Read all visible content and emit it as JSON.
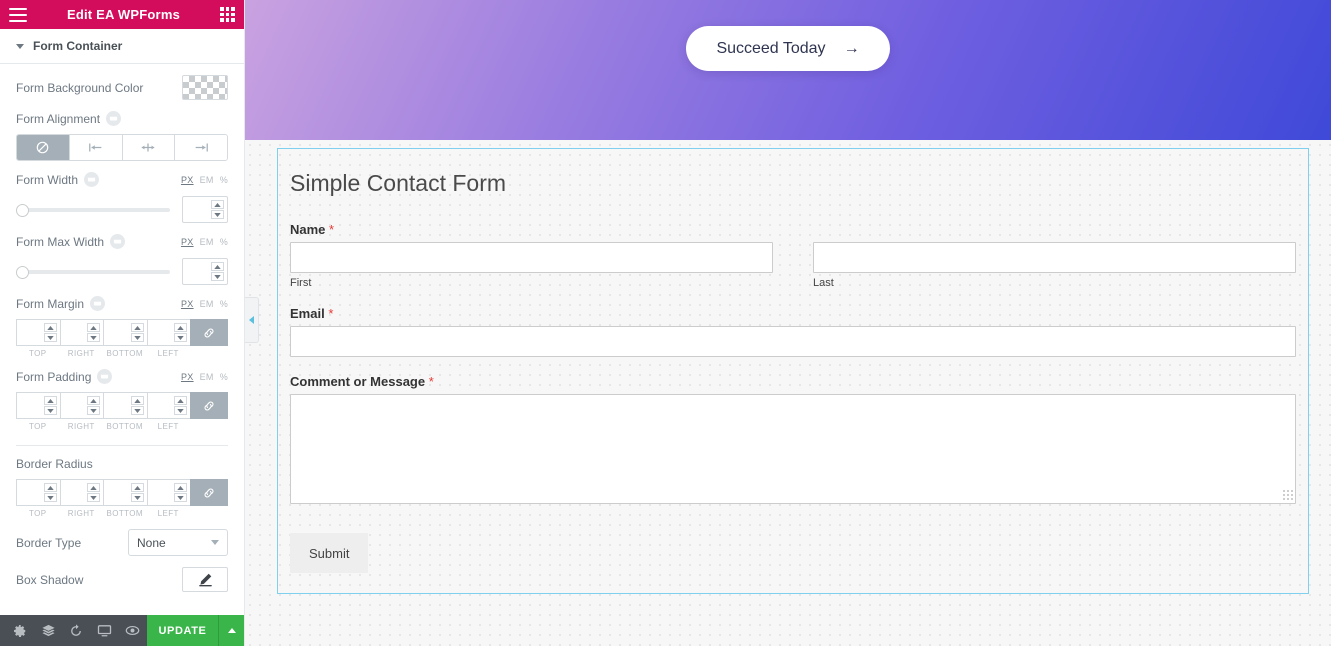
{
  "panel": {
    "header": {
      "title": "Edit EA WPForms",
      "menu_icon": "hamburger-icon",
      "widgets_icon": "grid-icon"
    },
    "section": {
      "title": "Form Container",
      "toggle_icon": "caret-down-icon"
    },
    "controls": {
      "background_color": {
        "label": "Form Background Color",
        "value": "transparent"
      },
      "alignment": {
        "label": "Form Alignment",
        "options": [
          "none",
          "left",
          "center",
          "right"
        ],
        "selected": "none"
      },
      "width": {
        "label": "Form Width",
        "units": [
          "PX",
          "EM",
          "%"
        ],
        "active_unit": "PX",
        "value": "",
        "slider_percent": 0
      },
      "max_width": {
        "label": "Form Max Width",
        "units": [
          "PX",
          "EM",
          "%"
        ],
        "active_unit": "PX",
        "value": "",
        "slider_percent": 0
      },
      "margin": {
        "label": "Form Margin",
        "units": [
          "PX",
          "EM",
          "%"
        ],
        "active_unit": "PX",
        "sides": [
          "TOP",
          "RIGHT",
          "BOTTOM",
          "LEFT"
        ],
        "values": [
          "",
          "",
          "",
          ""
        ],
        "linked": true
      },
      "padding": {
        "label": "Form Padding",
        "units": [
          "PX",
          "EM",
          "%"
        ],
        "active_unit": "PX",
        "sides": [
          "TOP",
          "RIGHT",
          "BOTTOM",
          "LEFT"
        ],
        "values": [
          "",
          "",
          "",
          ""
        ],
        "linked": true
      },
      "border_radius": {
        "label": "Border Radius",
        "sides": [
          "TOP",
          "RIGHT",
          "BOTTOM",
          "LEFT"
        ],
        "values": [
          "",
          "",
          "",
          ""
        ],
        "linked": true
      },
      "border_type": {
        "label": "Border Type",
        "value": "None"
      },
      "box_shadow": {
        "label": "Box Shadow",
        "edit_icon": "pencil-icon"
      }
    },
    "footer": {
      "icons": [
        "gear-icon",
        "layers-icon",
        "history-icon",
        "desktop-icon",
        "preview-eye-icon"
      ],
      "update_label": "UPDATE",
      "update_caret_icon": "caret-up-icon"
    },
    "collapse_icon": "chevron-left-icon"
  },
  "canvas": {
    "hero": {
      "button_label": "Succeed Today",
      "button_arrow": "→"
    },
    "form": {
      "title": "Simple Contact Form",
      "fields": [
        {
          "label": "Name",
          "required": "*",
          "type": "name",
          "parts": [
            {
              "sub_label": "First",
              "value": ""
            },
            {
              "sub_label": "Last",
              "value": ""
            }
          ]
        },
        {
          "label": "Email",
          "required": "*",
          "type": "text",
          "value": ""
        },
        {
          "label": "Comment or Message",
          "required": "*",
          "type": "textarea",
          "value": ""
        }
      ],
      "submit_label": "Submit"
    }
  },
  "colors": {
    "panel_header": "#d30c5c",
    "update_green": "#39b54a",
    "selection_border": "#7fd0ef",
    "required_red": "#e53935"
  }
}
